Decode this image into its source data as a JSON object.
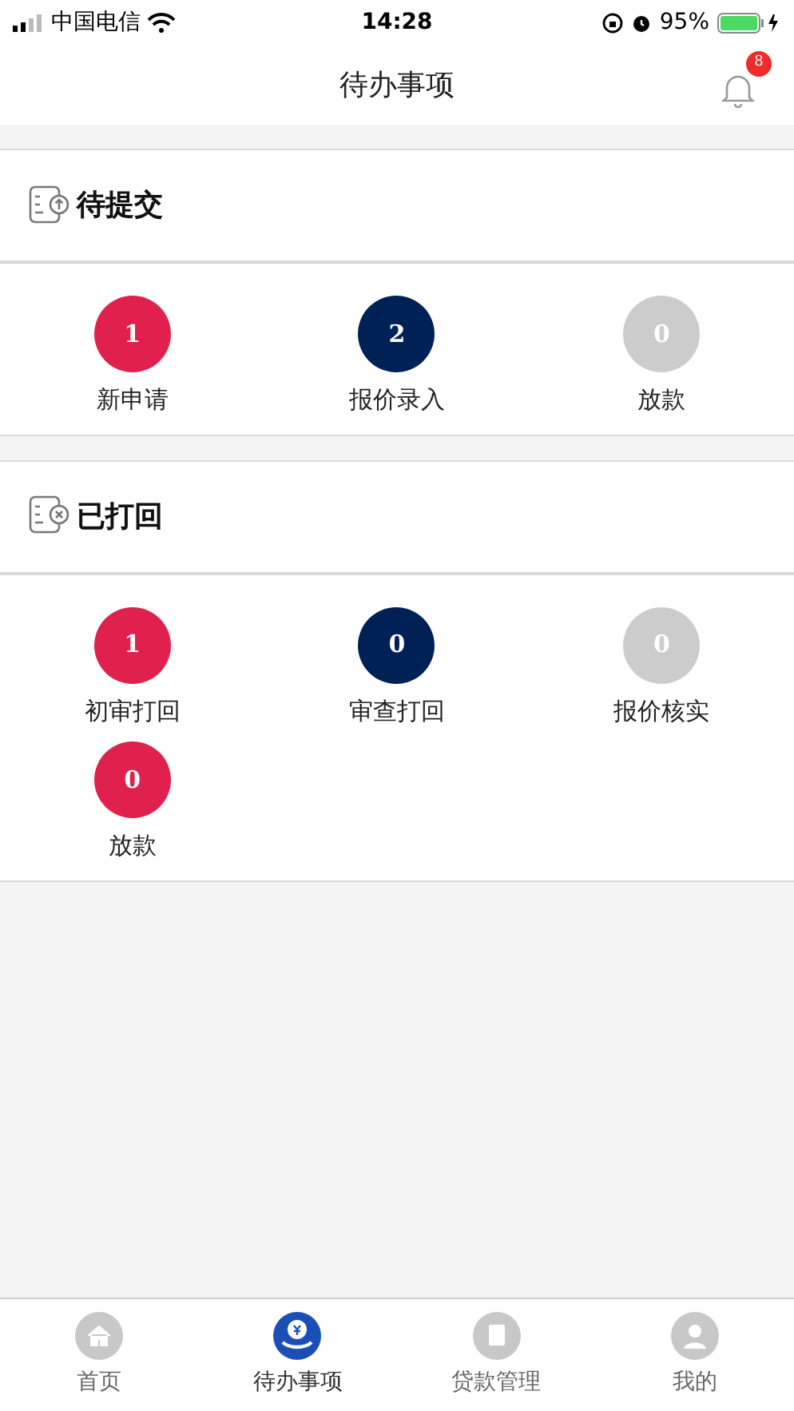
{
  "status_bar": {
    "carrier": "中国电信",
    "time": "14:28",
    "battery": "95%"
  },
  "header": {
    "title": "待办事项",
    "notification_count": "8"
  },
  "sections": [
    {
      "title": "待提交",
      "kind": "upload",
      "items": [
        {
          "count": "1",
          "label": "新申请",
          "color": "#e0214e"
        },
        {
          "count": "2",
          "label": "报价录入",
          "color": "#002156"
        },
        {
          "count": "0",
          "label": "放款",
          "color": "#cccccc"
        }
      ]
    },
    {
      "title": "已打回",
      "kind": "rejected",
      "items": [
        {
          "count": "1",
          "label": "初审打回",
          "color": "#e0214e"
        },
        {
          "count": "0",
          "label": "审查打回",
          "color": "#002156"
        },
        {
          "count": "0",
          "label": "报价核实",
          "color": "#cccccc"
        },
        {
          "count": "0",
          "label": "放款",
          "color": "#e0214e"
        }
      ]
    }
  ],
  "tab_bar": [
    {
      "label": "首页",
      "kind": "home",
      "selected": false
    },
    {
      "label": "待办事项",
      "kind": "todo",
      "selected": true
    },
    {
      "label": "贷款管理",
      "kind": "loan",
      "selected": false
    },
    {
      "label": "我的",
      "kind": "me",
      "selected": false
    }
  ]
}
